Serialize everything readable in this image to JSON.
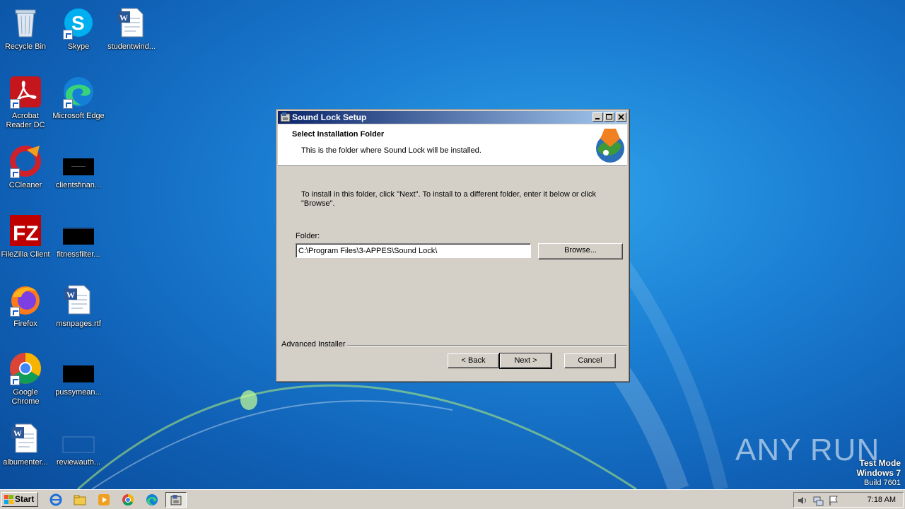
{
  "desktop": {
    "icons": [
      {
        "label": "Recycle Bin",
        "icon": "recycle-bin-icon"
      },
      {
        "label": "Skype",
        "icon": "skype-icon"
      },
      {
        "label": "studentwind...",
        "icon": "word-doc-icon"
      },
      {
        "label": "Acrobat Reader DC",
        "icon": "acrobat-icon"
      },
      {
        "label": "Microsoft Edge",
        "icon": "edge-icon"
      },
      {
        "label": "CCleaner",
        "icon": "ccleaner-icon"
      },
      {
        "label": "clientsfinan...",
        "icon": "black-file-icon"
      },
      {
        "label": "FileZilla Client",
        "icon": "filezilla-icon"
      },
      {
        "label": "fitnessfilter...",
        "icon": "black-file-icon"
      },
      {
        "label": "Firefox",
        "icon": "firefox-icon"
      },
      {
        "label": "msnpages.rtf",
        "icon": "word-doc-icon"
      },
      {
        "label": "Google Chrome",
        "icon": "chrome-icon"
      },
      {
        "label": "pussymean...",
        "icon": "black-file-icon"
      },
      {
        "label": "albumenter...",
        "icon": "word-doc-icon"
      },
      {
        "label": "reviewauth...",
        "icon": "blank-file-icon"
      }
    ]
  },
  "dialog": {
    "title": "Sound Lock Setup",
    "header_title": "Select Installation Folder",
    "header_subtitle": "This is the folder where Sound Lock will be installed.",
    "instructions": "To install in this folder, click \"Next\". To install to a different folder, enter it below or click \"Browse\".",
    "folder_label": "Folder:",
    "folder_value": "C:\\Program Files\\3-APPES\\Sound Lock\\",
    "browse_label": "Browse...",
    "brand": "Advanced Installer",
    "back_label": "< Back",
    "next_label": "Next >",
    "cancel_label": "Cancel"
  },
  "taskbar": {
    "start_label": "Start",
    "clock": "7:18 AM"
  },
  "watermark": "ANY RUN",
  "mode": {
    "line1": "Test Mode",
    "line2": "Windows 7",
    "line3": "Build 7601"
  }
}
